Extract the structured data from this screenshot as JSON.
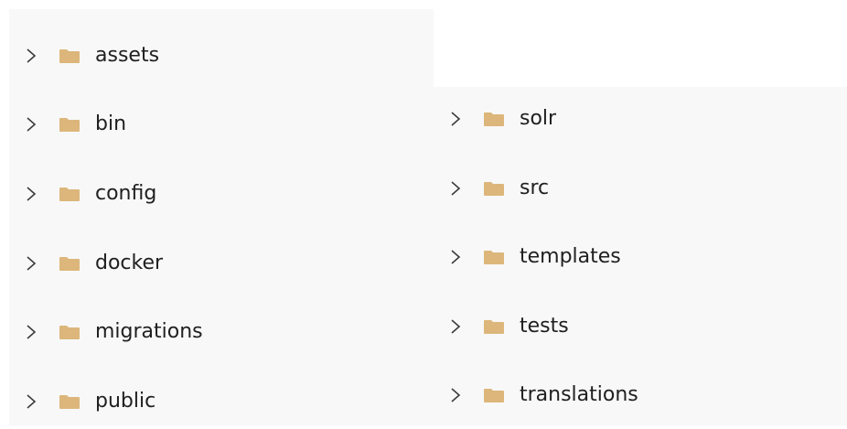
{
  "left_panel": {
    "items": [
      {
        "label": "assets",
        "icon": "folder-icon"
      },
      {
        "label": "bin",
        "icon": "folder-icon"
      },
      {
        "label": "config",
        "icon": "folder-icon"
      },
      {
        "label": "docker",
        "icon": "folder-icon"
      },
      {
        "label": "migrations",
        "icon": "folder-icon"
      },
      {
        "label": "public",
        "icon": "folder-icon"
      }
    ]
  },
  "right_panel": {
    "items": [
      {
        "label": "solr",
        "icon": "folder-icon"
      },
      {
        "label": "src",
        "icon": "folder-icon"
      },
      {
        "label": "templates",
        "icon": "folder-icon"
      },
      {
        "label": "tests",
        "icon": "folder-icon"
      },
      {
        "label": "translations",
        "icon": "folder-icon"
      }
    ]
  },
  "colors": {
    "panel_background": "#f8f8f8",
    "folder": "#dcb67a",
    "chevron": "#3c3c3c",
    "text": "#202020"
  }
}
